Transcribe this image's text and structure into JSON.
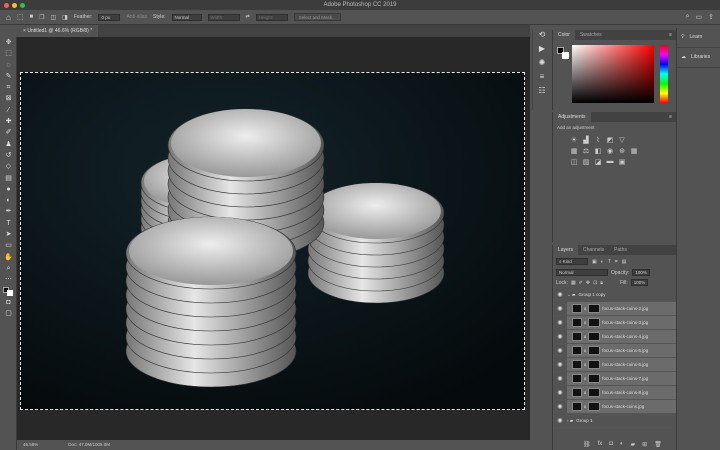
{
  "app": {
    "title": "Adobe Photoshop CC 2019"
  },
  "options": {
    "feather_label": "Feather:",
    "feather_value": "0 px",
    "anti_alias": "Anti-alias",
    "style_label": "Style:",
    "style_value": "Normal",
    "width_label": "Width:",
    "height_label": "Height:",
    "select_mask": "Select and Mask..."
  },
  "document": {
    "tab": "Untitled1 @ 46.6% (RGB/8) *",
    "zoom": "46.58%",
    "doc_info": "Doc: 47.0M/1005.0M"
  },
  "color_panel": {
    "tabs": [
      "Color",
      "Swatches"
    ]
  },
  "adjustments": {
    "title": "Adjustments",
    "hint": "Add an adjustment"
  },
  "far_panel": {
    "learn": "Learn",
    "libraries": "Libraries"
  },
  "layers_panel": {
    "tabs": [
      "Layers",
      "Channels",
      "Paths"
    ],
    "filter": "Kind",
    "blend": "Normal",
    "opacity_label": "Opacity:",
    "opacity": "100%",
    "lock_label": "Lock:",
    "fill_label": "Fill:",
    "fill": "100%",
    "group_open": "Group 1 copy",
    "layers": [
      "focus-stack-coins-2.jpg",
      "focus-stack-coins-3.jpg",
      "focus-stack-coins-4.jpg",
      "focus-stack-coins-5.jpg",
      "focus-stack-coins-6.jpg",
      "focus-stack-coins-7.jpg",
      "focus-stack-coins-8.jpg",
      "focus-stack-coins.jpg"
    ],
    "group_closed": "Group 1"
  },
  "colors": {
    "accent": "#ff0000",
    "panel": "#535353",
    "canvas": "#282828"
  }
}
